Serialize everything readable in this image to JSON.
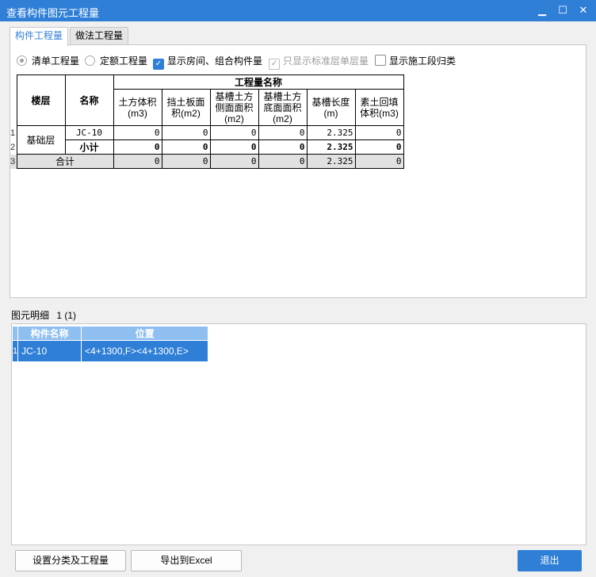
{
  "window": {
    "title": "查看构件图元工程量",
    "minimize": "▁",
    "maximize": "☐",
    "close": "✕"
  },
  "tabs": [
    {
      "label": "构件工程量"
    },
    {
      "label": "做法工程量"
    }
  ],
  "options": {
    "radio_list": "清单工程量",
    "radio_quota": "定额工程量",
    "chk_rooms": "显示房间、组合构件量",
    "chk_std_floor": "只显示标准层单层量",
    "chk_segments": "显示施工段归类"
  },
  "table": {
    "header_floor": "楼层",
    "header_name": "名称",
    "header_group": "工程量名称",
    "columns": [
      "土方体积(m3)",
      "挡土板面积(m2)",
      "基槽土方侧面面积(m2)",
      "基槽土方底面面积(m2)",
      "基槽长度(m)",
      "素土回填体积(m3)"
    ],
    "rows": [
      {
        "num": "1",
        "floor": "基础层",
        "name": "JC-10",
        "values": [
          "0",
          "0",
          "0",
          "0",
          "2.325",
          "0"
        ]
      },
      {
        "num": "2",
        "name": "小计",
        "values": [
          "0",
          "0",
          "0",
          "0",
          "2.325",
          "0"
        ]
      },
      {
        "num": "3",
        "name": "合计",
        "values": [
          "0",
          "0",
          "0",
          "0",
          "2.325",
          "0"
        ]
      }
    ]
  },
  "detail": {
    "label": "图元明细",
    "count": "1 (1)",
    "headers": [
      "构件名称",
      "位置"
    ],
    "rows": [
      {
        "num": "1",
        "name": "JC-10",
        "position": "<4+1300,F><4+1300,E>"
      }
    ]
  },
  "buttons": {
    "settings": "设置分类及工程量",
    "export": "导出到Excel",
    "exit": "退出"
  }
}
